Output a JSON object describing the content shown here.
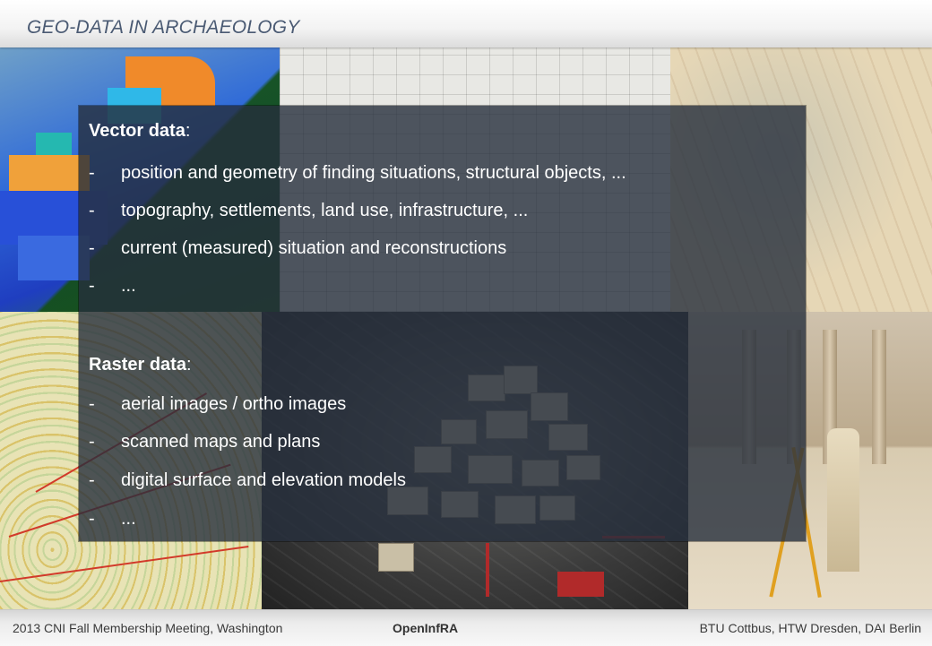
{
  "header": {
    "title": "GEO-DATA IN ARCHAEOLOGY"
  },
  "panel": {
    "vector": {
      "heading": "Vector data",
      "colon": ":",
      "items": [
        "position and geometry of finding situations, structural objects, ...",
        "topography, settlements, land use, infrastructure, ...",
        "current (measured) situation and reconstructions",
        "..."
      ]
    },
    "raster": {
      "heading": "Raster data",
      "colon": ":",
      "items": [
        "aerial images / ortho images",
        "scanned maps and plans",
        "digital surface and elevation models",
        "..."
      ]
    },
    "dash": "-"
  },
  "footer": {
    "left": "2013 CNI Fall Membership Meeting, Washington",
    "center": "OpenInfRA",
    "right": "BTU Cottbus, HTW Dresden, DAI Berlin"
  },
  "colors": {
    "title": "#4a5a73",
    "panel_bg": "#262e3c",
    "panel_text": "#ffffff"
  },
  "icons": [
    "city-3d-model-image",
    "floor-plan-image",
    "historic-map-image",
    "topographic-map-image",
    "aerial-3d-city-image",
    "ruins-surveyor-photo"
  ]
}
